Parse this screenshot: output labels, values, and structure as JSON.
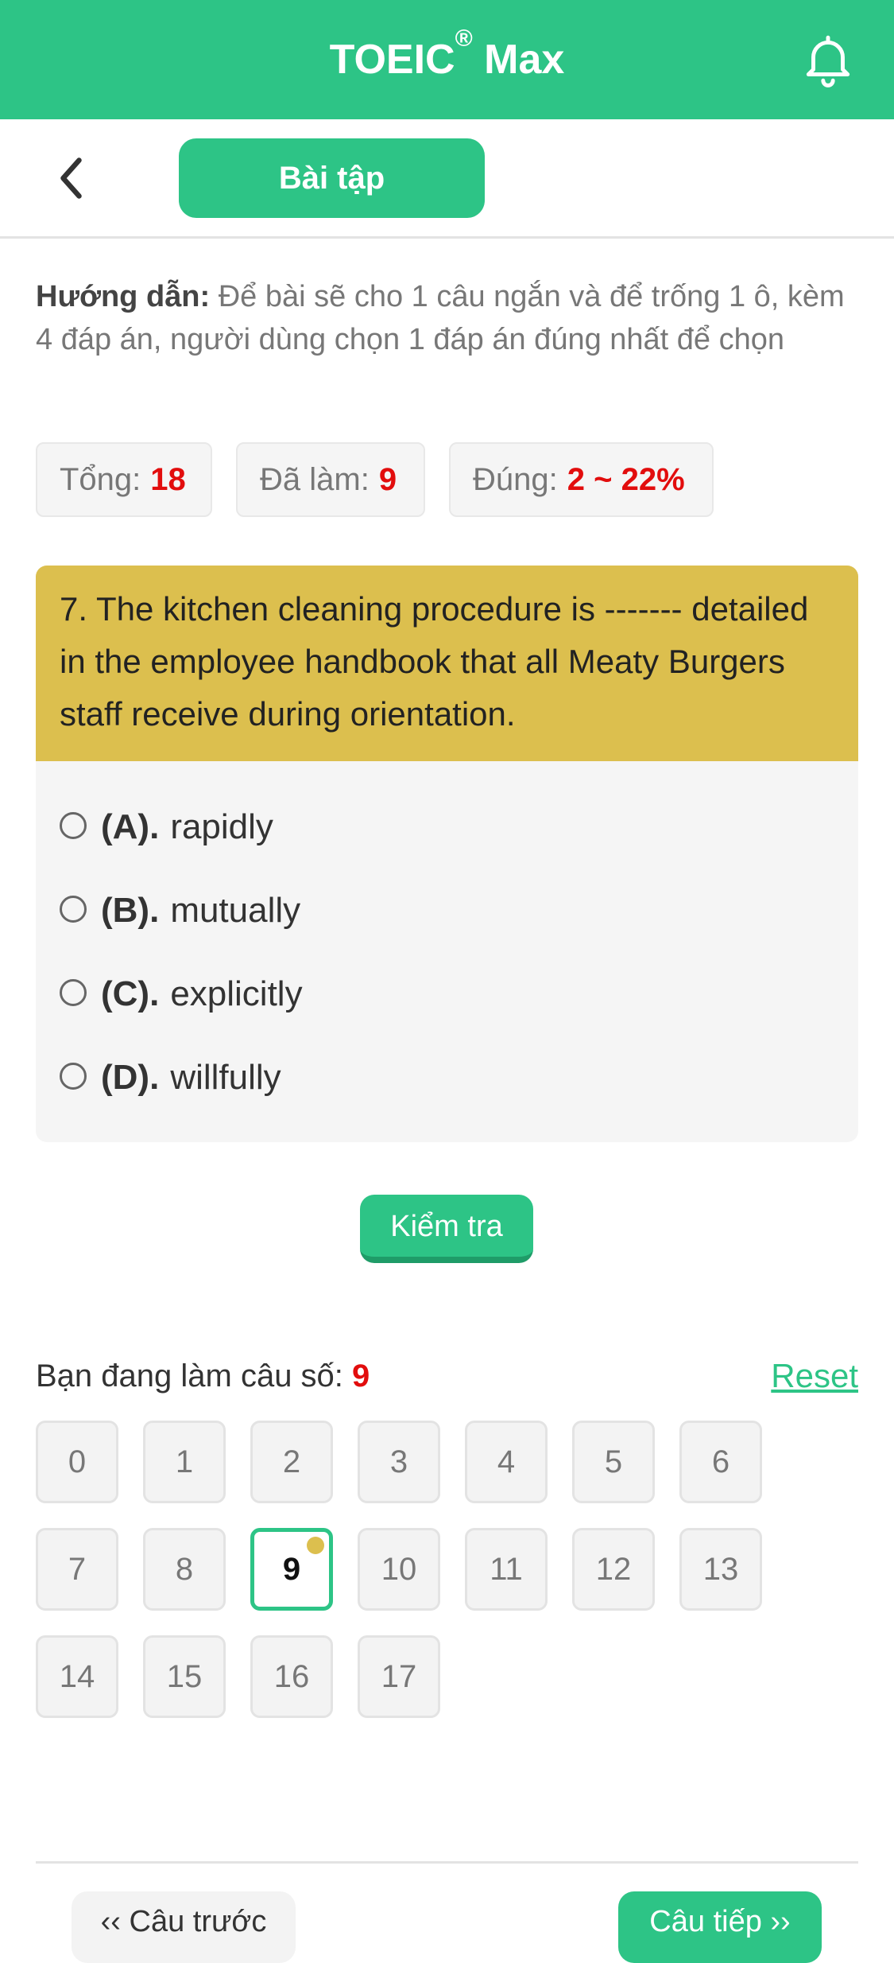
{
  "header": {
    "title": "TOEIC",
    "title_mark": "®",
    "title_suffix": " Max",
    "bell_icon": "bell-icon"
  },
  "toolbar": {
    "back_icon": "chevron-left-icon",
    "tab_label": "Bài tập"
  },
  "instructions": {
    "label": "Hướng dẫn:",
    "text": " Để bài sẽ cho 1 câu ngắn và để trống 1 ô, kèm 4 đáp án, người dùng chọn 1 đáp án đúng nhất để chọn"
  },
  "stats": {
    "total_label": "Tổng:",
    "total_value": "18",
    "done_label": "Đã làm:",
    "done_value": "9",
    "correct_label": "Đúng:",
    "correct_value": "2 ~ 22%"
  },
  "question": {
    "text": "7. The kitchen cleaning procedure is ------- detailed in the employee handbook that all Meaty Burgers staff receive during orientation.",
    "options": [
      {
        "key": "(A).",
        "text": "rapidly"
      },
      {
        "key": "(B).",
        "text": "mutually"
      },
      {
        "key": "(C).",
        "text": "explicitly"
      },
      {
        "key": "(D).",
        "text": "willfully"
      }
    ]
  },
  "check_button": "Kiểm tra",
  "navigator": {
    "current_label": "Bạn đang làm câu số: ",
    "current_value": "9",
    "reset_label": "Reset",
    "numbers": [
      "0",
      "1",
      "2",
      "3",
      "4",
      "5",
      "6",
      "7",
      "8",
      "9",
      "10",
      "11",
      "12",
      "13",
      "14",
      "15",
      "16",
      "17"
    ],
    "active_index": 9
  },
  "footer": {
    "prev_label": "‹‹ Câu trước",
    "next_label": "Câu tiếp ››"
  },
  "colors": {
    "brand": "#2dc486",
    "question_bg": "#dcbf4e",
    "highlight": "#e20d0d"
  }
}
